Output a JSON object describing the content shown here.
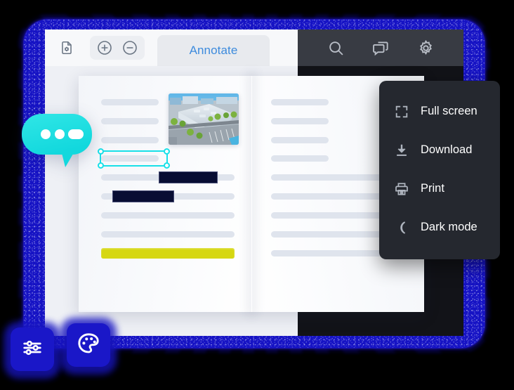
{
  "app": {
    "name": "document-viewer",
    "toolbar": {
      "doc_settings_icon": "document-gear-icon",
      "zoom_in_icon": "zoom-in-icon",
      "zoom_out_icon": "zoom-out-icon",
      "annotate_tab_label": "Annotate",
      "search_icon": "search-icon",
      "comments_icon": "comments-icon",
      "settings_icon": "gear-icon"
    },
    "menu": {
      "items": [
        {
          "label": "Full screen",
          "icon": "fullscreen-icon"
        },
        {
          "label": "Download",
          "icon": "download-icon"
        },
        {
          "label": "Print",
          "icon": "print-icon"
        },
        {
          "label": "Dark mode",
          "icon": "moon-icon"
        }
      ]
    },
    "floating_buttons": [
      {
        "name": "adjustments-button",
        "icon": "sliders-icon"
      },
      {
        "name": "theme-palette-button",
        "icon": "palette-icon"
      }
    ],
    "chat_bubble": {
      "icon": "chat-bubble-icon",
      "dots": 3
    },
    "document": {
      "left_page": {
        "photo_alt": "aerial-photo-of-commercial-building",
        "annotations": {
          "selection_box": "text-selection-box",
          "redaction_bars": 2,
          "highlight_bars": 1
        },
        "text_lines": 9
      },
      "right_page": {
        "text_lines": 9
      }
    }
  },
  "colors": {
    "frame_blue": "#1613c4",
    "accent_blue": "#1a17c8",
    "link_blue": "#3d8bdd",
    "cyan": "#18e0e8",
    "highlight_yellow": "#d6d711",
    "redaction_navy": "#080d33",
    "toolbar_dark": "#383b43",
    "menu_dark": "#25282f",
    "viewer_dark": "#121318",
    "text_line_gray": "#dfe4ed"
  }
}
